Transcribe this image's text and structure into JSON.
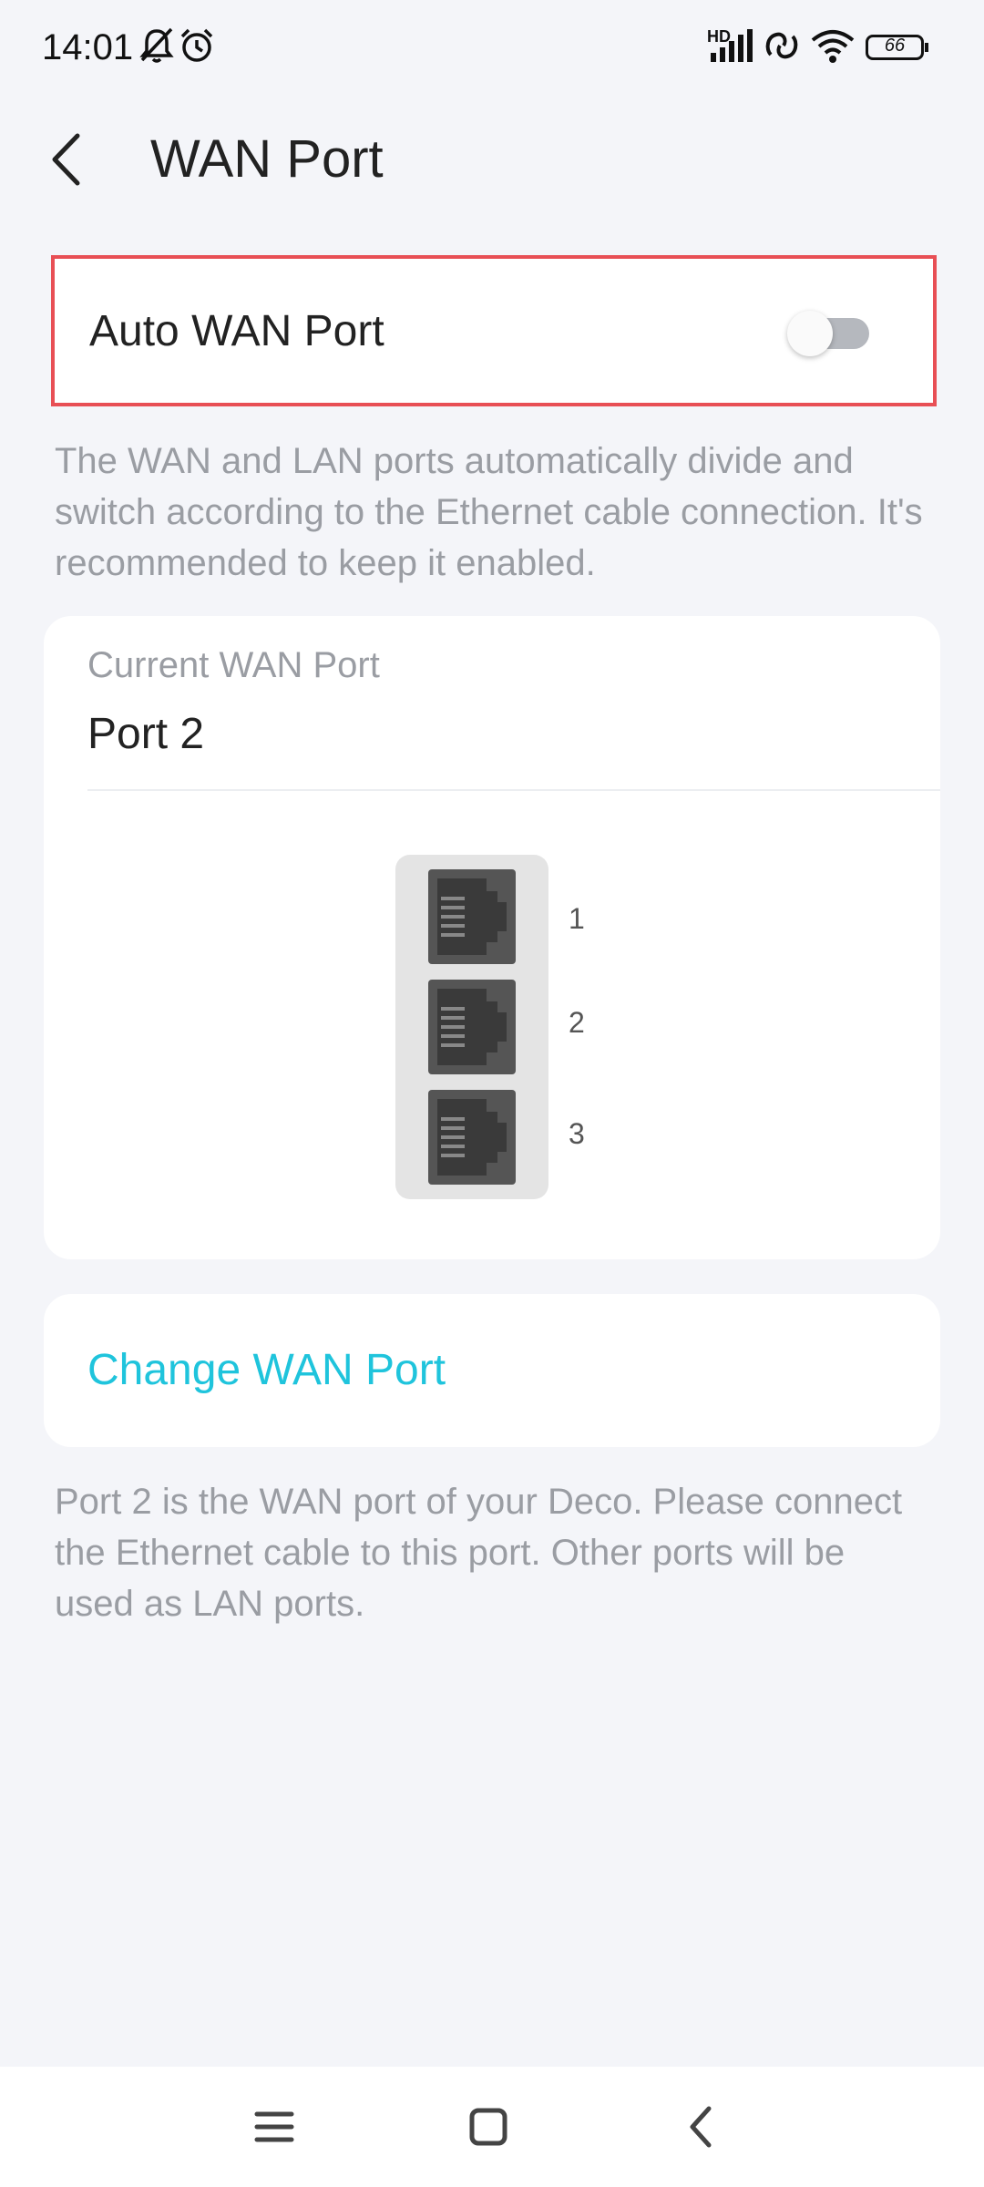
{
  "status": {
    "time": "14:01",
    "battery": "66",
    "network_badge": "HD"
  },
  "header": {
    "title": "WAN Port"
  },
  "auto_wan": {
    "label": "Auto WAN Port",
    "enabled": false,
    "description": "The WAN and LAN ports automatically divide and switch according to the Ethernet cable connection. It's recommended to keep it enabled."
  },
  "current_wan": {
    "label": "Current WAN Port",
    "value": "Port 2",
    "ports": [
      "1",
      "2",
      "3"
    ]
  },
  "change_wan": {
    "label": "Change WAN Port"
  },
  "footer_note": "Port 2 is the WAN port of your Deco. Please connect the Ethernet cable to this port. Other ports will be used as LAN ports.",
  "colors": {
    "accent": "#1fc4dc",
    "highlight_border": "#e84f55"
  }
}
